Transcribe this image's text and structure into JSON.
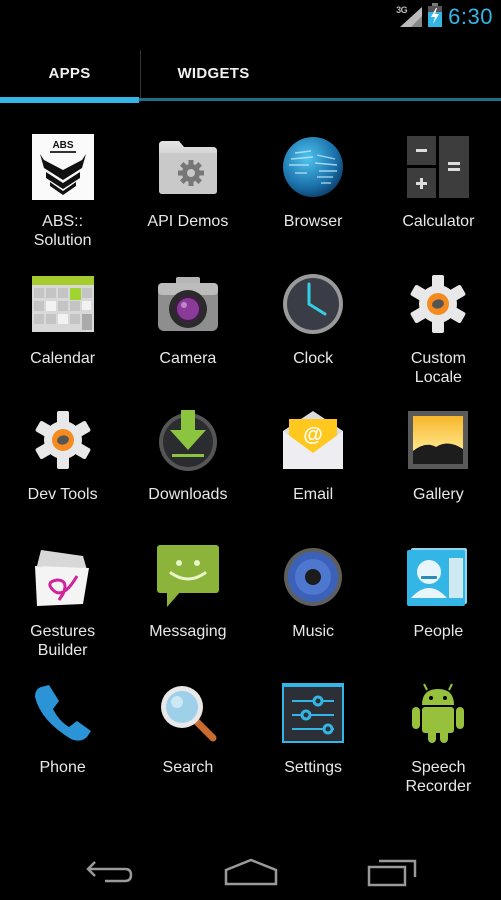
{
  "status_bar": {
    "network_type": "3G",
    "time": "6:30",
    "accent_color": "#33b5e5"
  },
  "tabs": [
    {
      "label": "APPS",
      "selected": true
    },
    {
      "label": "WIDGETS",
      "selected": false
    }
  ],
  "apps": [
    {
      "label": "ABS::\nSolution",
      "icon": "abs-logo-icon"
    },
    {
      "label": "API Demos",
      "icon": "folder-gear-icon"
    },
    {
      "label": "Browser",
      "icon": "globe-icon"
    },
    {
      "label": "Calculator",
      "icon": "calculator-icon"
    },
    {
      "label": "Calendar",
      "icon": "calendar-icon"
    },
    {
      "label": "Camera",
      "icon": "camera-icon"
    },
    {
      "label": "Clock",
      "icon": "clock-icon"
    },
    {
      "label": "Custom\nLocale",
      "icon": "gear-icon"
    },
    {
      "label": "Dev Tools",
      "icon": "gear-icon"
    },
    {
      "label": "Downloads",
      "icon": "download-icon"
    },
    {
      "label": "Email",
      "icon": "email-icon"
    },
    {
      "label": "Gallery",
      "icon": "gallery-icon"
    },
    {
      "label": "Gestures\nBuilder",
      "icon": "gestures-icon"
    },
    {
      "label": "Messaging",
      "icon": "messaging-icon"
    },
    {
      "label": "Music",
      "icon": "speaker-icon"
    },
    {
      "label": "People",
      "icon": "contact-card-icon"
    },
    {
      "label": "Phone",
      "icon": "phone-icon"
    },
    {
      "label": "Search",
      "icon": "magnifier-icon"
    },
    {
      "label": "Settings",
      "icon": "sliders-icon"
    },
    {
      "label": "Speech\nRecorder",
      "icon": "android-robot-icon"
    }
  ],
  "nav_bar": {
    "back": "back-icon",
    "home": "home-icon",
    "recents": "recents-icon"
  }
}
